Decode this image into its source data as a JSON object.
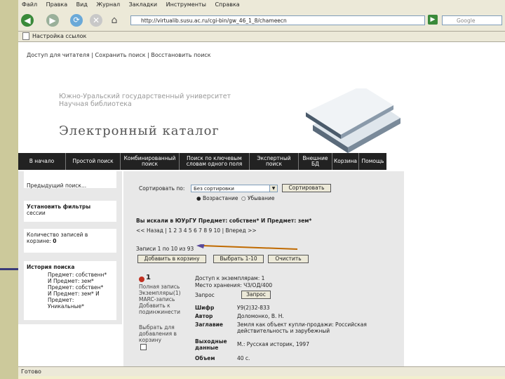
{
  "browser": {
    "menu": [
      "Файл",
      "Правка",
      "Вид",
      "Журнал",
      "Закладки",
      "Инструменты",
      "Справка"
    ],
    "address": "http://virtualib.susu.ac.ru/cgi-bin/gw_46_1_8/chameecn",
    "search_placeholder": "Google",
    "bookmark": "Настройка ссылок",
    "status": "Готово"
  },
  "header": {
    "toplinks": "Доступ для читателя | Сохранить поиск | Восстановить поиск",
    "university_line1": "Южно-Уральский государственный университет",
    "university_line2": "Научная библиотека",
    "catalog_title": "Электронный каталог"
  },
  "nav": [
    "В начало",
    "Простой поиск",
    "Комбинированный поиск",
    "Поиск по ключевым словам одного поля",
    "Экспертный поиск",
    "Внешние БД",
    "Корзина",
    "Помощь"
  ],
  "left": {
    "prev_search": "Предыдущий поиск...",
    "filters": "Установить фильтры",
    "filters_sub": "сессии",
    "count_label": "Количество записей в корзине:",
    "count_value": "0",
    "history_title": "История поиска",
    "history_1": "Предмет: собственн*",
    "history_2": "И Предмет: зем*",
    "history_3": "Предмет: собствен*",
    "history_4": "И Предмет: зем* И",
    "history_5": "Предмет:",
    "history_6": "Уникальные*"
  },
  "main": {
    "sort_label": "Сортировать по:",
    "sort_value": "Без сортировки",
    "sort_button": "Сортировать",
    "asc": "Возрастание",
    "desc": "Убывание",
    "searched_prefix": "Вы искали",
    "searched_in": "в ЮУрГУ",
    "searched_query": "Предмет: собствен* И Предмет: зем*",
    "pager": "<< Назад | 1 2 3 4 5 6 7 8 9 10 | Вперед >>",
    "records": "Записи 1 по 10 из 93",
    "add_button": "Добавить в корзину",
    "select_button": "Выбрать 1-10",
    "clear_button": "Очистить",
    "rec_num": "1",
    "full_record": "Полная запись",
    "full_record_2": "Экземпляры(1)",
    "full_record_3": "MARC-запись",
    "full_record_4": "Добавить к",
    "full_record_5": "подинжинести",
    "select_label": "Выбрать для",
    "select_label_2": "добавления в",
    "select_label_3": "корзину",
    "access_label": "Доступ к экземплярам: 1",
    "place_label": "Место хранения: ЧЗ/ОД/400",
    "request_label": "Запрос",
    "request_button": "Запрос",
    "shifr_label": "Шифр",
    "shifr_value": "У9(2)32-833",
    "author_label": "Автор",
    "author_value": "Доломонко, В. Н.",
    "title_label": "Заглавие",
    "title_value": "Земля как объект купли-продажи: Российская",
    "title_value_2": "действительность и зарубежный",
    "pub_label": "Выходные",
    "pub_label_2": "данные",
    "pub_value": "М.: Русская историк, 1997",
    "vol_label": "Объем",
    "vol_value": "40 с."
  }
}
